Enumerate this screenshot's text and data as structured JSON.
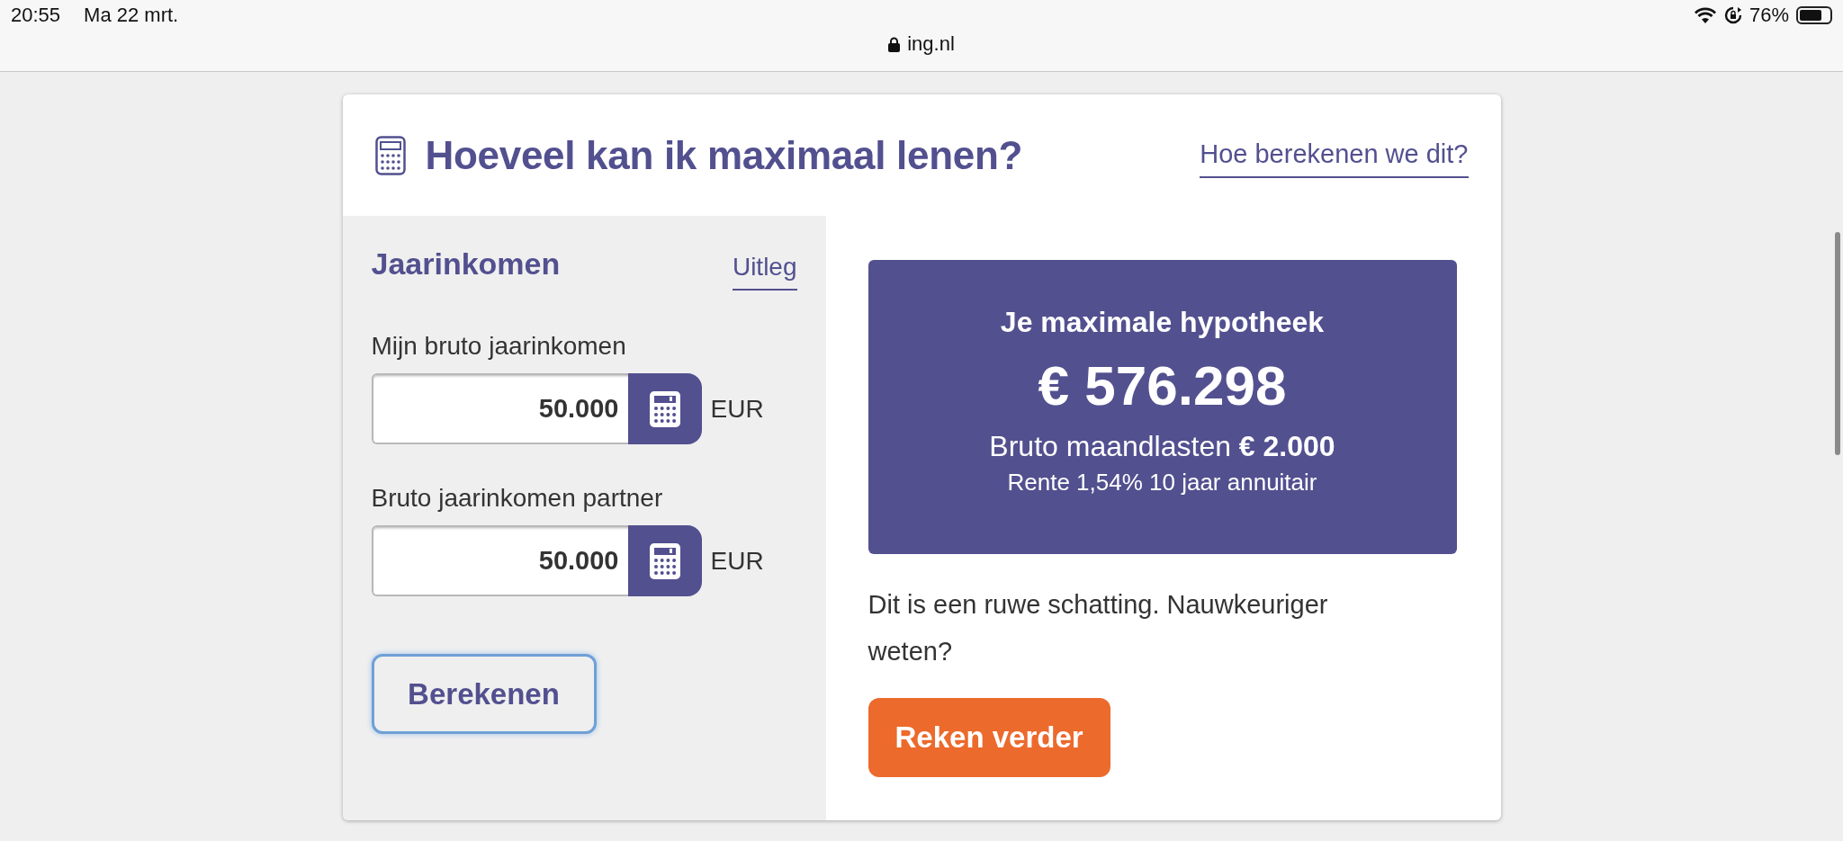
{
  "status_bar": {
    "time": "20:55",
    "date": "Ma 22 mrt.",
    "battery": "76%"
  },
  "address_bar": {
    "url": "ing.nl"
  },
  "card": {
    "title": "Hoeveel kan ik maximaal lenen?",
    "help_link": "Hoe berekenen we dit?"
  },
  "income": {
    "heading": "Jaarinkomen",
    "link": "Uitleg",
    "fields": [
      {
        "label": "Mijn bruto jaarinkomen",
        "value": "50.000",
        "unit": "EUR"
      },
      {
        "label": "Bruto jaarinkomen partner",
        "value": "50.000",
        "unit": "EUR"
      }
    ],
    "button": {
      "label": "Berekenen",
      "focused": true
    }
  },
  "result": {
    "title": "Je maximale hypotheek",
    "amount": "€ 576.298",
    "monthly": "Bruto maandlasten **€ 2.000**",
    "rate": "Rente 1,54% 10 jaar annuitair"
  },
  "note": "Dit is een ruwe schatting. Nauwkeuriger weten?",
  "cta": "Reken verder"
}
